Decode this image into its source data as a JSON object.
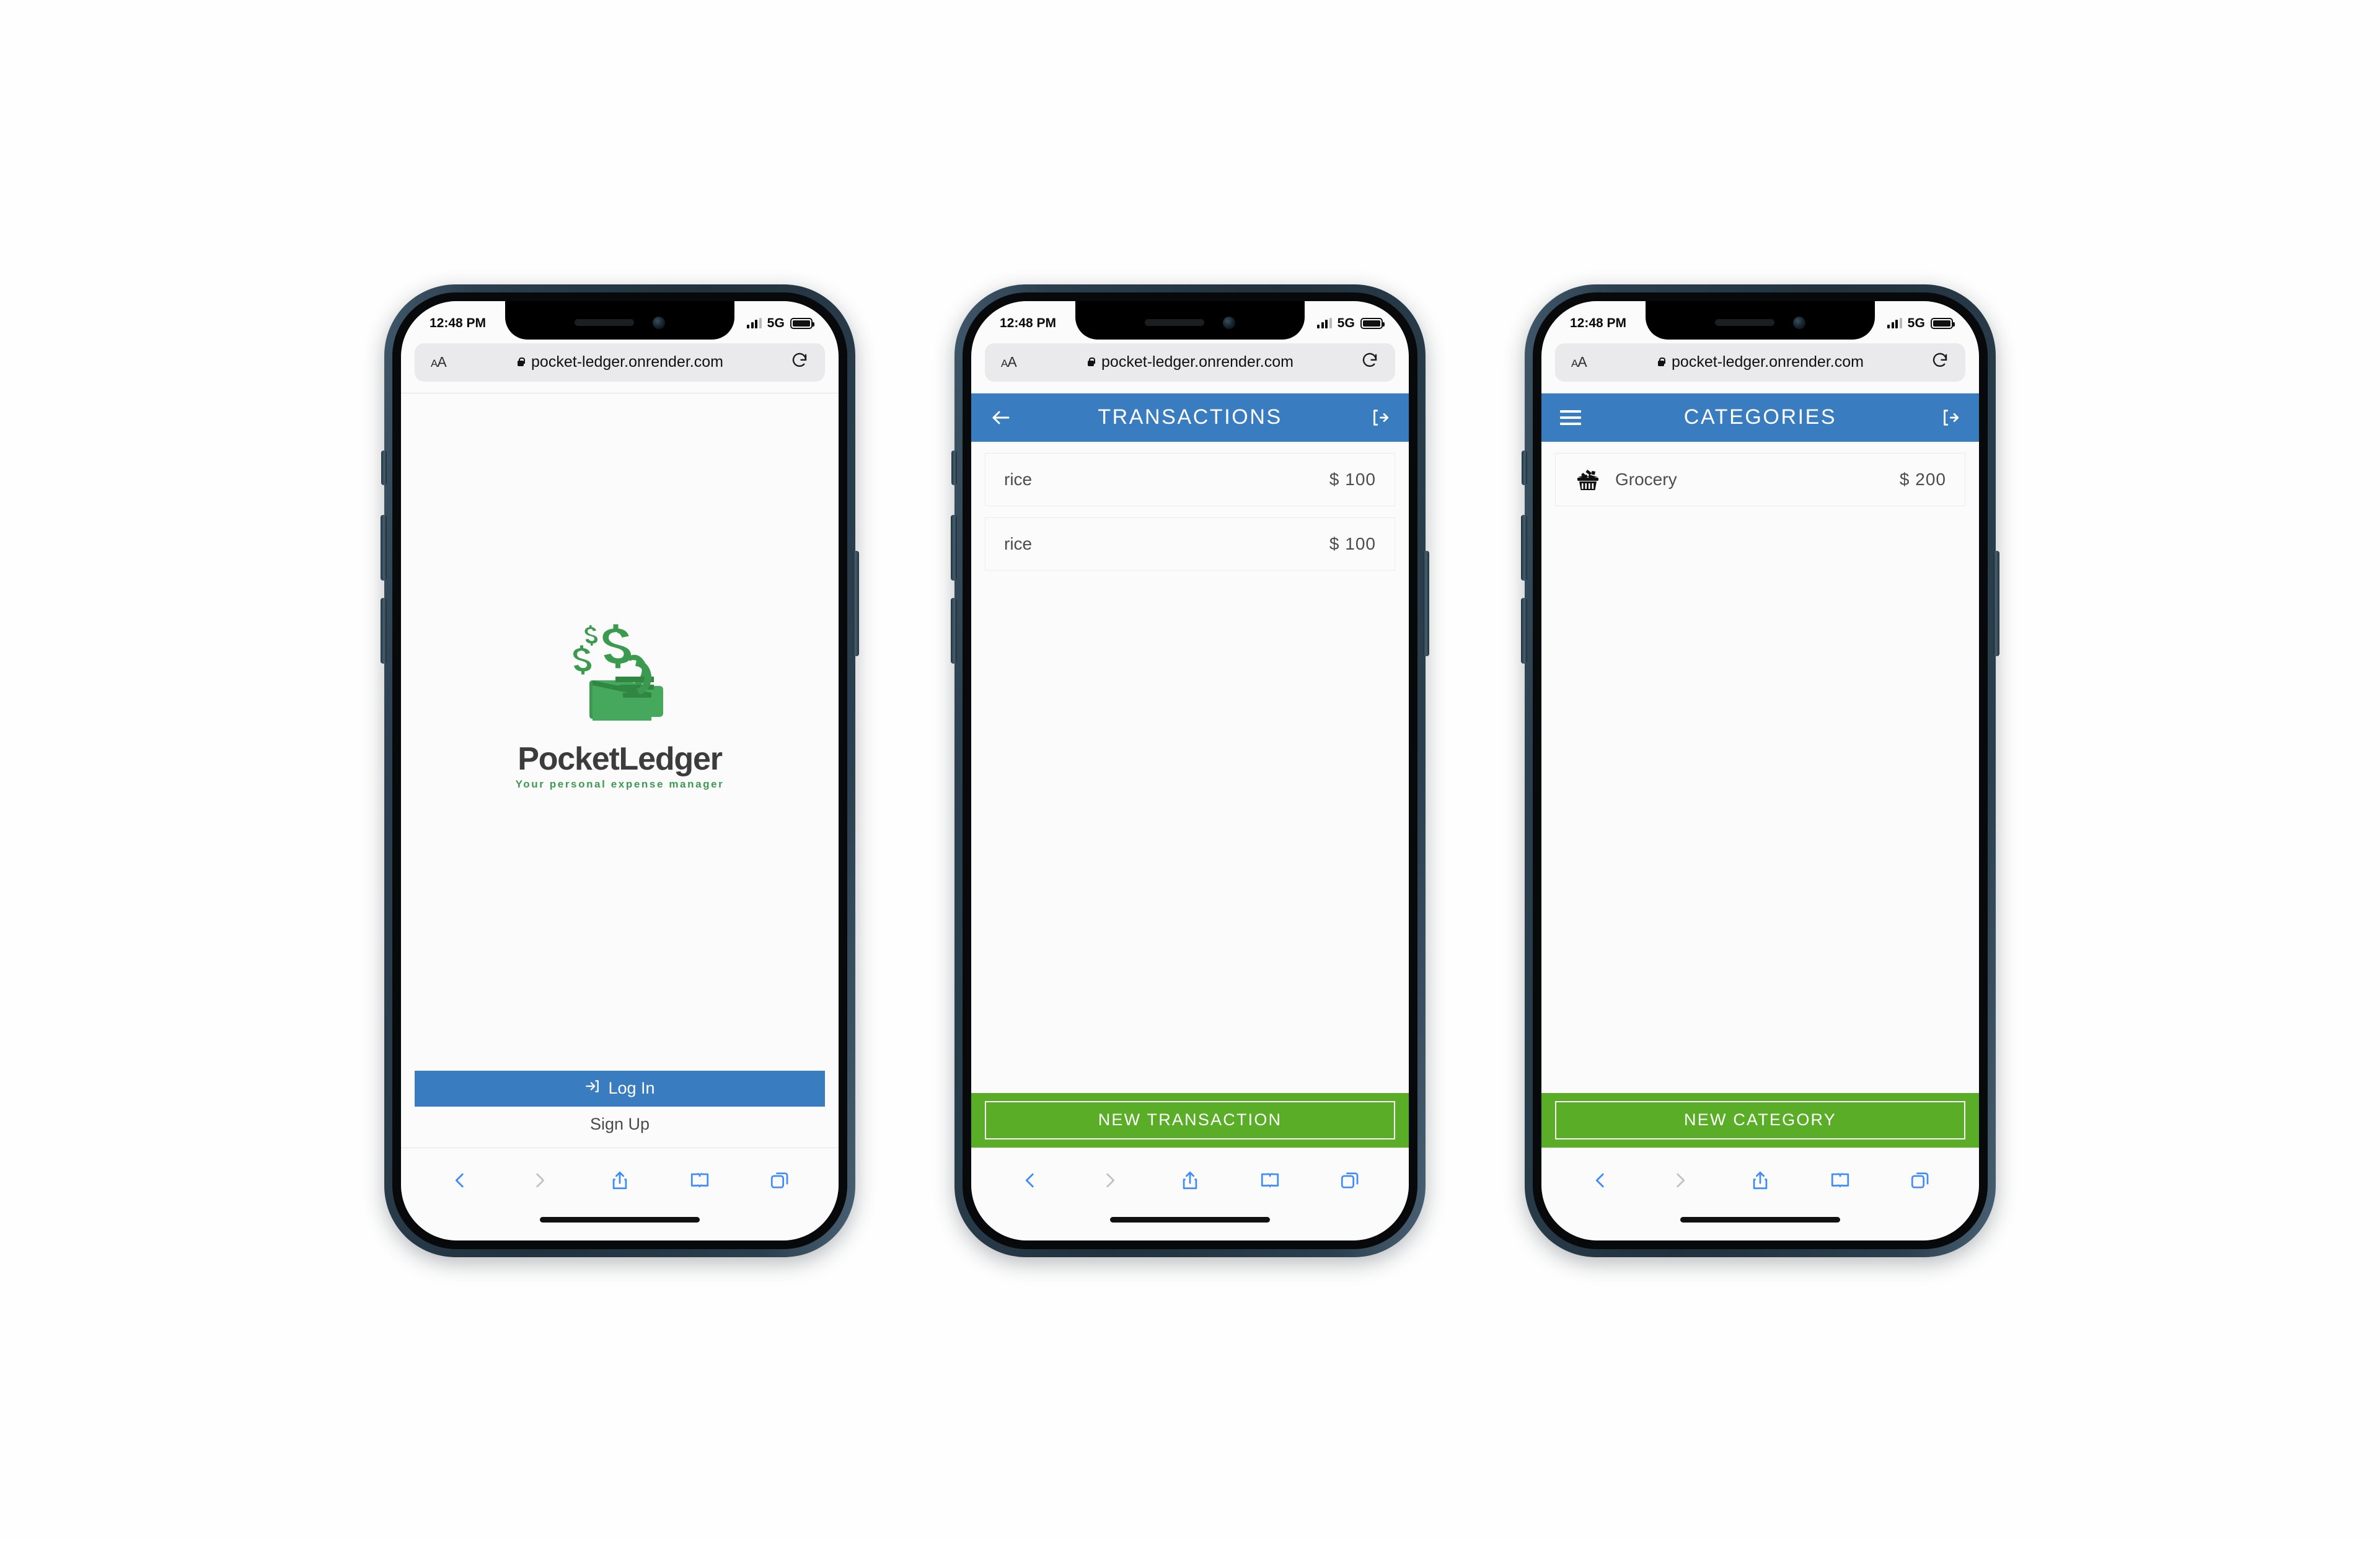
{
  "status_bar": {
    "time": "12:48 PM",
    "network": "5G",
    "signal_icon": "signal-bars-icon",
    "battery_icon": "battery-full-icon"
  },
  "browser": {
    "text_size_label": "AA",
    "lock_icon": "lock-icon",
    "url": "pocket-ledger.onrender.com",
    "reload_icon": "reload-icon",
    "toolbar": {
      "back_icon": "chevron-left-icon",
      "forward_icon": "chevron-right-icon",
      "share_icon": "share-icon",
      "bookmarks_icon": "book-icon",
      "tabs_icon": "tabs-icon"
    }
  },
  "phones": [
    {
      "screen_name": "splash-login",
      "logo": {
        "icon": "pocketledger-wallet-icon",
        "name": "PocketLedger",
        "tagline": "Your personal expense manager"
      },
      "login_button": {
        "label": "Log In",
        "icon": "sign-in-icon",
        "color": "#3a7cc0"
      },
      "signup_link": {
        "label": "Sign Up"
      }
    },
    {
      "screen_name": "transactions",
      "header": {
        "title": "TRANSACTIONS",
        "left_icon": "arrow-left-icon",
        "right_icon": "logout-icon",
        "color": "#3a7cc0"
      },
      "rows": [
        {
          "label": "rice",
          "amount": "$ 100"
        },
        {
          "label": "rice",
          "amount": "$ 100"
        }
      ],
      "cta": {
        "label": "NEW TRANSACTION",
        "color": "#5aad26"
      }
    },
    {
      "screen_name": "categories",
      "header": {
        "title": "CATEGORIES",
        "left_icon": "hamburger-menu-icon",
        "right_icon": "logout-icon",
        "color": "#3a7cc0"
      },
      "rows": [
        {
          "icon": "shopping-basket-icon",
          "label": "Grocery",
          "amount": "$ 200"
        }
      ],
      "cta": {
        "label": "NEW CATEGORY",
        "color": "#5aad26"
      }
    }
  ]
}
